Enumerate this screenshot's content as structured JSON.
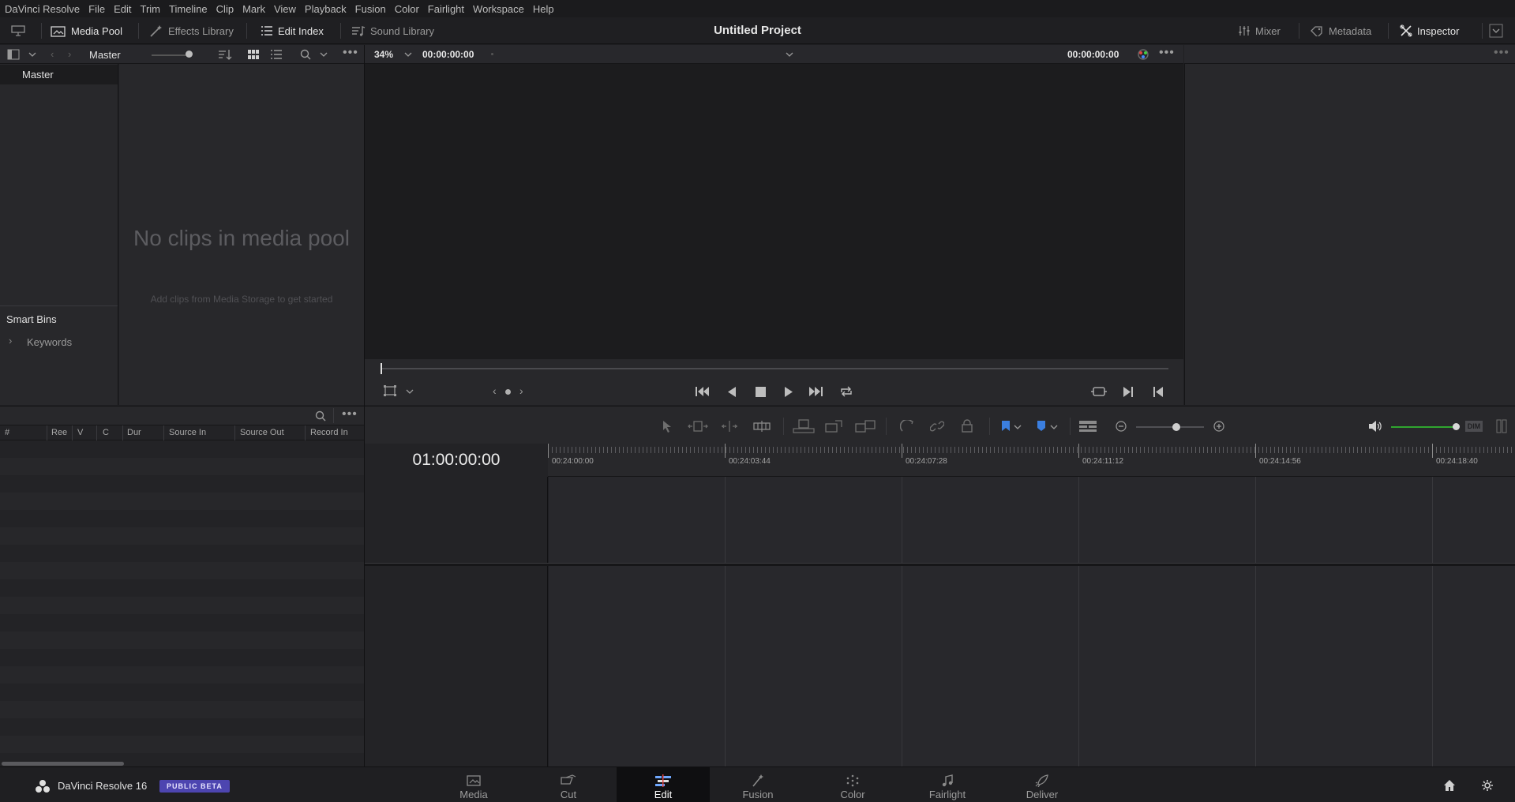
{
  "menu": [
    "DaVinci Resolve",
    "File",
    "Edit",
    "Trim",
    "Timeline",
    "Clip",
    "Mark",
    "View",
    "Playback",
    "Fusion",
    "Color",
    "Fairlight",
    "Workspace",
    "Help"
  ],
  "toolbar": {
    "media_pool": "Media Pool",
    "effects_library": "Effects Library",
    "edit_index": "Edit Index",
    "sound_library": "Sound Library",
    "project_title": "Untitled Project",
    "mixer": "Mixer",
    "metadata": "Metadata",
    "inspector": "Inspector"
  },
  "media_pool": {
    "bin_label": "Master",
    "selected_bin": "Master",
    "empty_title": "No clips in media pool",
    "empty_hint": "Add clips from Media Storage to get started",
    "smart_bins": "Smart Bins",
    "keywords": "Keywords"
  },
  "viewer": {
    "zoom": "34%",
    "source_timecode": "00:00:00:00",
    "program_timecode": "00:00:00:00"
  },
  "edit_index": {
    "columns": [
      "#",
      "Ree",
      "V",
      "C",
      "Dur",
      "Source In",
      "Source Out",
      "Record In"
    ]
  },
  "timeline": {
    "timecode": "01:00:00:00",
    "ruler": [
      "00:24:00:00",
      "00:24:03:44",
      "00:24:07:28",
      "00:24:11:12",
      "00:24:14:56",
      "00:24:18:40"
    ],
    "dim_label": "DIM"
  },
  "bottom": {
    "app_name": "DaVinci Resolve 16",
    "badge": "PUBLIC BETA",
    "pages": [
      "Media",
      "Cut",
      "Edit",
      "Fusion",
      "Color",
      "Fairlight",
      "Deliver"
    ],
    "active_page": "Edit"
  },
  "colors": {
    "accent_blue": "#3b7fe0",
    "audio_green": "#2fa52f",
    "badge_purple": "#4d45b0"
  }
}
